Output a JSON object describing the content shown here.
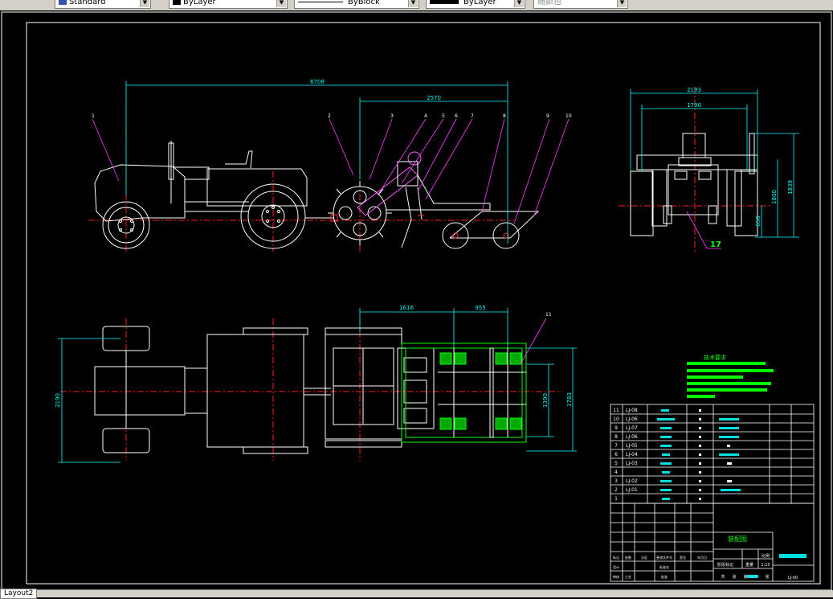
{
  "toolbar": {
    "text_style": "Standard",
    "layer_color": "ByLayer",
    "linetype": "ByBlock",
    "lineweight": "ByLayer",
    "plot_style": "随颜色"
  },
  "layout_tab": "Layout2",
  "drawing": {
    "side_view": {
      "dim_overall": "6708",
      "dim_rear": "2570",
      "balloons": [
        "1",
        "2",
        "3",
        "4",
        "5",
        "6",
        "7",
        "8",
        "9",
        "10"
      ]
    },
    "rear_view": {
      "dim_width": "2193",
      "dim_track": "1790",
      "dim_height_a": "1839",
      "dim_height_b": "1800",
      "dim_height_c": "650",
      "balloon": "17"
    },
    "top_view": {
      "dim_a": "1616",
      "dim_b": "955",
      "dim_width": "2190",
      "dim_c": "1390",
      "dim_d": "1783",
      "balloon": "11"
    },
    "tech_requirements_title": "技术要求",
    "bom_rows": [
      {
        "no": "11",
        "code": "LJ-08"
      },
      {
        "no": "10",
        "code": "LJ-06"
      },
      {
        "no": "9",
        "code": "LJ-07"
      },
      {
        "no": "8",
        "code": "LJ-06"
      },
      {
        "no": "7",
        "code": "LJ-05"
      },
      {
        "no": "6",
        "code": "LJ-04"
      },
      {
        "no": "5",
        "code": "LJ-03"
      },
      {
        "no": "4",
        "code": ""
      },
      {
        "no": "3",
        "code": "LJ-02"
      },
      {
        "no": "2",
        "code": "LJ-01"
      },
      {
        "no": "1",
        "code": ""
      }
    ],
    "title_block": {
      "name": "装配图",
      "scale_label": "比例",
      "scale": "1:15",
      "drawing_no": "LJ-00",
      "weight_label": "重量",
      "stage_label": "阶段标记",
      "left_labels": [
        "标记",
        "处数",
        "分区",
        "更改文件号",
        "签名",
        "年月日"
      ],
      "row_labels": [
        "设计",
        "审核",
        "工艺",
        "标准化",
        "批准"
      ],
      "sheet_labels": [
        "共",
        "张",
        "第",
        "张"
      ]
    }
  }
}
